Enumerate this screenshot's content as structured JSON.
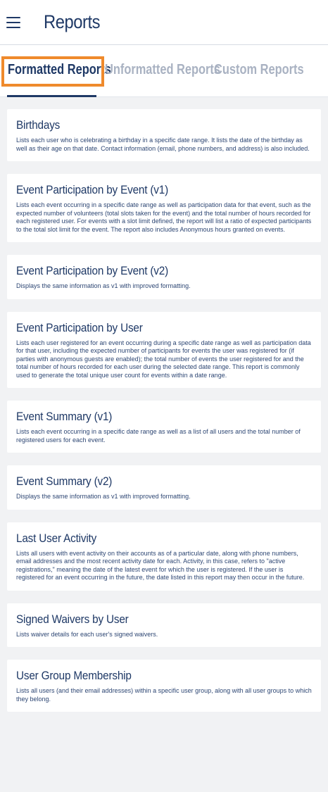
{
  "header": {
    "title": "Reports"
  },
  "tabs": [
    {
      "label": "Formatted Reports",
      "active": true
    },
    {
      "label": "Unformatted Reports",
      "active": false
    },
    {
      "label": "Custom Reports",
      "active": false
    }
  ],
  "reports": [
    {
      "title": "Birthdays",
      "description": "Lists each user who is celebrating a birthday in a specific date range. It lists the date of the birthday as well as their age on that date. Contact information (email, phone numbers, and address) is also included."
    },
    {
      "title": "Event Participation by Event (v1)",
      "description": "Lists each event occurring in a specific date range as well as participation data for that event, such as the expected number of volunteers (total slots taken for the event) and the total number of hours recorded for each registered user. For events with a slot limit defined, the report will list a ratio of expected participants to the total slot limit for the event. The report also includes Anonymous hours granted on events."
    },
    {
      "title": "Event Participation by Event (v2)",
      "description": "Displays the same information as v1 with improved formatting."
    },
    {
      "title": "Event Participation by User",
      "description": "Lists each user registered for an event occurring during a specific date range as well as participation data for that user, including the expected number of participants for events the user was registered for (if parties with anonymous guests are enabled); the total number of events the user registered for and the total number of hours recorded for each user during the selected date range. This report is commonly used to generate the total unique user count for events within a date range."
    },
    {
      "title": "Event Summary (v1)",
      "description": "Lists each event occurring in a specific date range as well as a list of all users and the total number of registered users for each event."
    },
    {
      "title": "Event Summary (v2)",
      "description": "Displays the same information as v1 with improved formatting."
    },
    {
      "title": "Last User Activity",
      "description": "Lists all users with event activity on their accounts as of a particular date, along with phone numbers, email addresses and the most recent activity date for each. Activity, in this case, refers to \"active registrations,\" meaning the date of the latest event for which the user is registered. If the user is registered for an event occurring in the future, the date listed in this report may then occur in the future."
    },
    {
      "title": "Signed Waivers by User",
      "description": "Lists waiver details for each user's signed waivers."
    },
    {
      "title": "User Group Membership",
      "description": "Lists all users (and their email addresses) within a specific user group, along with all user groups to which they belong."
    }
  ],
  "colors": {
    "primary": "#1f3966",
    "inactive_tab": "#a9b2c2",
    "highlight": "#ef8a2c",
    "background": "#f1f2f4"
  },
  "icons": {
    "menu": "hamburger-menu-icon"
  }
}
